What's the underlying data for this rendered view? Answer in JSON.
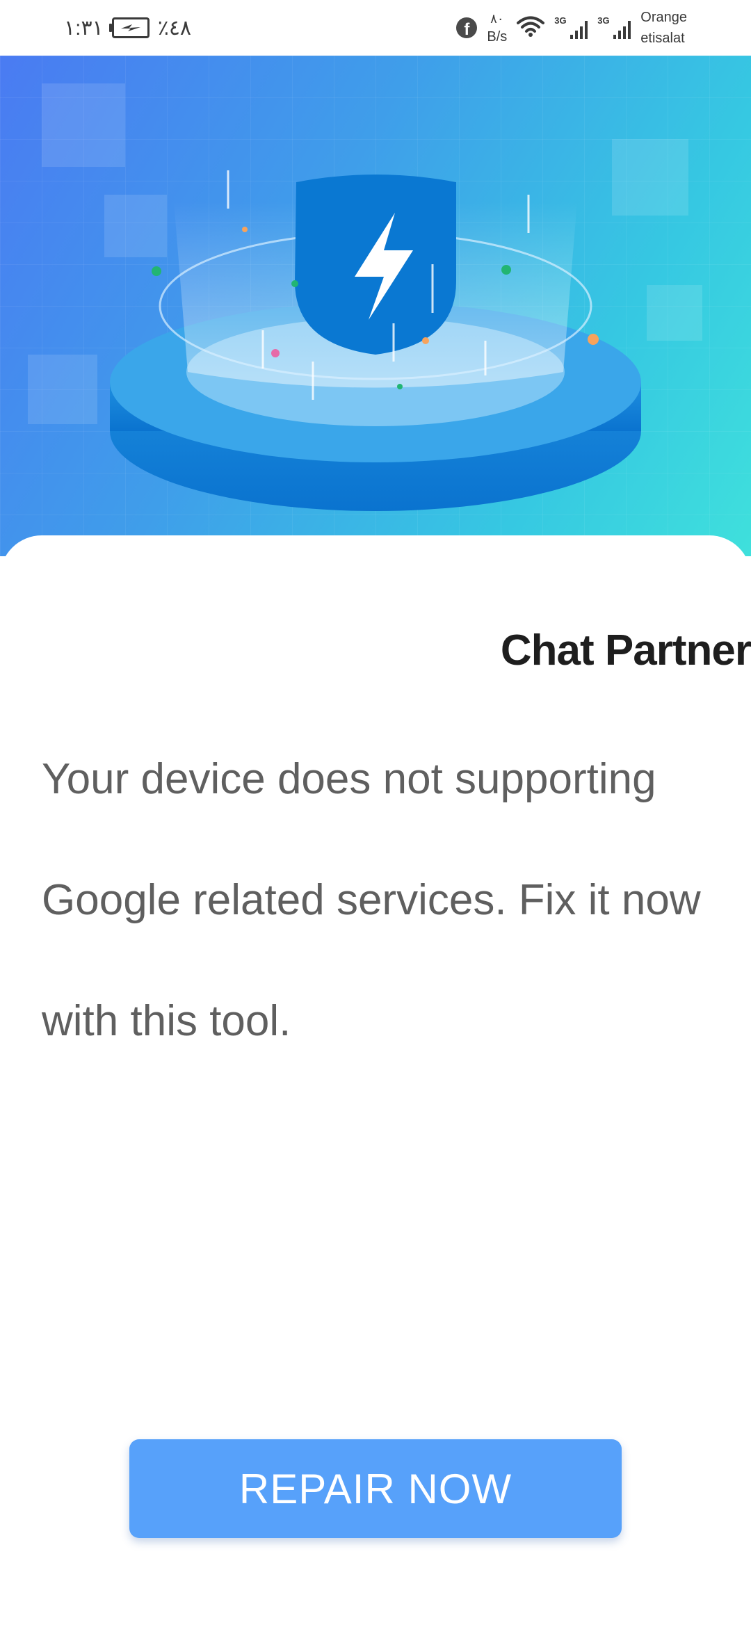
{
  "status_bar": {
    "time": "١:٣١",
    "battery_percent": "٪٤٨",
    "battery_state": "charging",
    "net_speed_value": "٨٠",
    "net_speed_unit": "B/s",
    "sim_tag_1": "3G",
    "sim_tag_2": "3G",
    "carrier_line_1": "Orange",
    "carrier_line_2": "etisalat",
    "icons": [
      "battery-charging-icon",
      "facebook-icon",
      "wifi-icon",
      "signal-icon",
      "signal-icon"
    ]
  },
  "hero": {
    "illustration": "shield-lightning-icon"
  },
  "content": {
    "app_name": "Chat Partner",
    "message": "Your device does not supporting Google related services. Fix it now with this tool."
  },
  "actions": {
    "repair_label": "REPAIR NOW"
  },
  "colors": {
    "accent_button": "#57a1fa",
    "hero_gradient_start": "#4a7bf2",
    "hero_gradient_end": "#3fe0dc",
    "shield": "#0a78d2",
    "title_text": "#1e1e1e",
    "body_text": "#5f5f5f"
  }
}
